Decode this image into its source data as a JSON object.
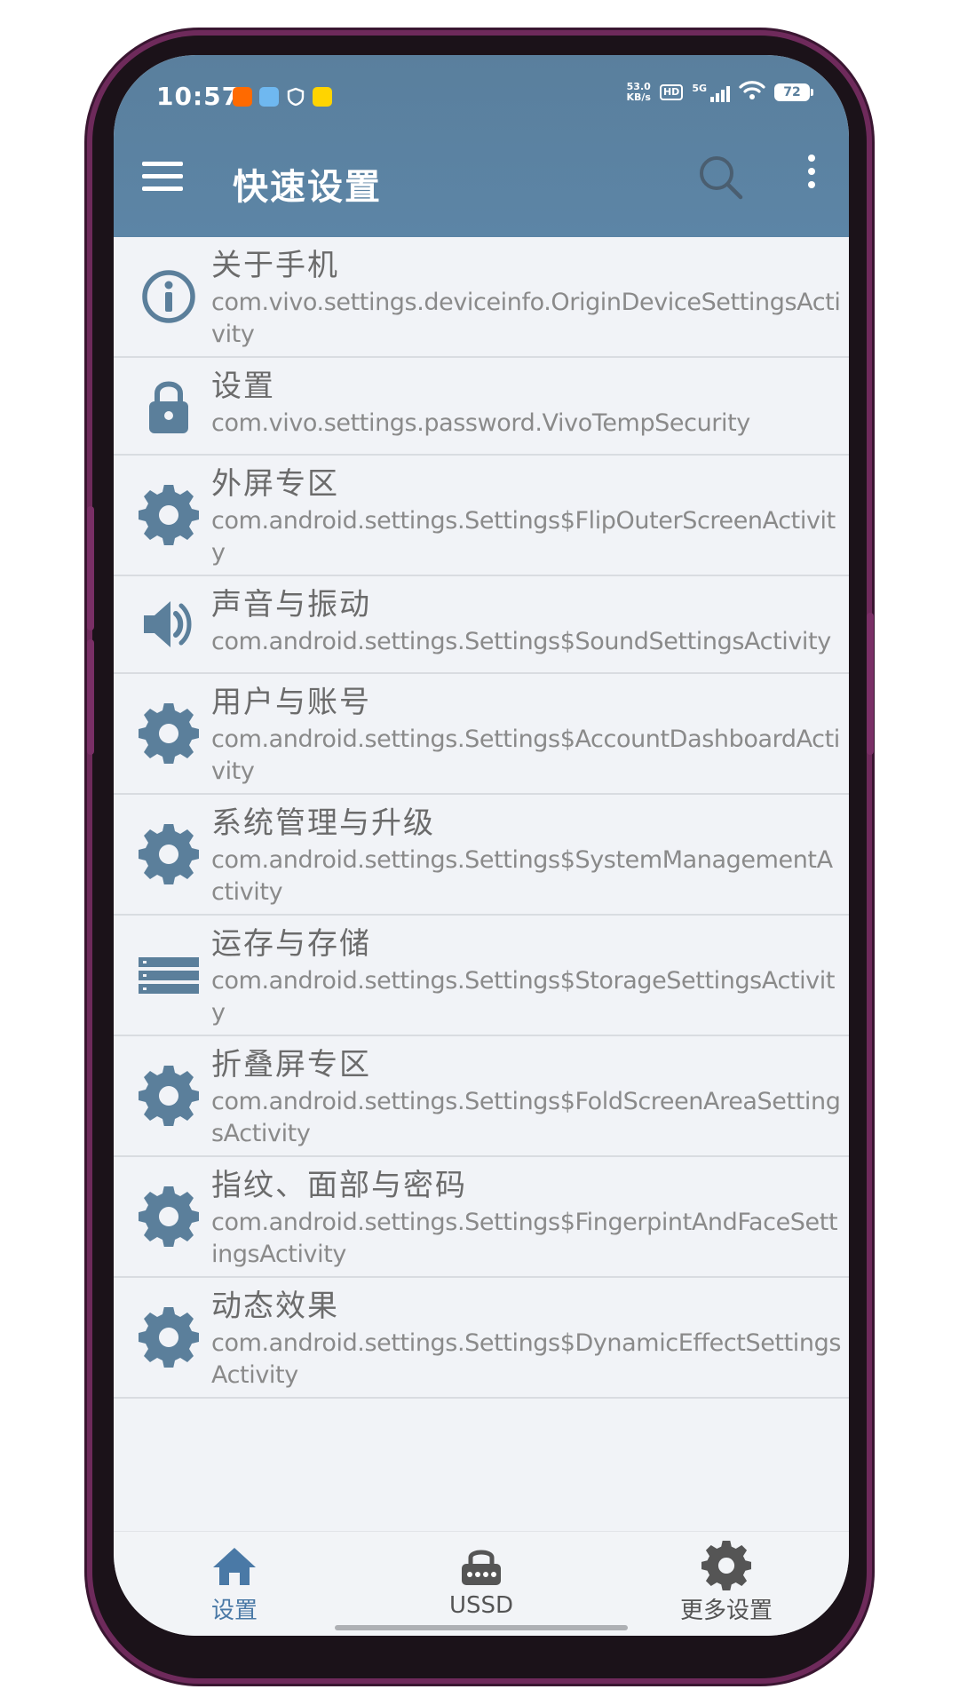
{
  "colors": {
    "header": "#5a7f9d",
    "icon": "#5b7f9b",
    "nav_active": "#4a79a6",
    "nav_inactive": "#666666"
  },
  "status_bar": {
    "time": "10:57",
    "net_speed_value": "53.0",
    "net_speed_unit": "KB/s",
    "hd": "HD",
    "network": "5G",
    "battery": "72"
  },
  "toolbar": {
    "title": "快速设置",
    "menu_icon": "hamburger-icon",
    "search_icon": "search-icon",
    "more_icon": "more-vert-icon"
  },
  "items": [
    {
      "icon": "info-icon",
      "title": "关于手机",
      "subtitle": "com.vivo.settings.deviceinfo.OriginDeviceSettingsActivity"
    },
    {
      "icon": "lock-icon",
      "title": "设置",
      "subtitle": "com.vivo.settings.password.VivoTempSecurity"
    },
    {
      "icon": "gear-icon",
      "title": "外屏专区",
      "subtitle": "com.android.settings.Settings$FlipOuterScreenActivity"
    },
    {
      "icon": "speaker-icon",
      "title": "声音与振动",
      "subtitle": "com.android.settings.Settings$SoundSettingsActivity"
    },
    {
      "icon": "gear-icon",
      "title": "用户与账号",
      "subtitle": "com.android.settings.Settings$AccountDashboardActivity"
    },
    {
      "icon": "gear-icon",
      "title": "系统管理与升级",
      "subtitle": "com.android.settings.Settings$SystemManagementActivity"
    },
    {
      "icon": "storage-icon",
      "title": "运存与存储",
      "subtitle": "com.android.settings.Settings$StorageSettingsActivity"
    },
    {
      "icon": "gear-icon",
      "title": "折叠屏专区",
      "subtitle": "com.android.settings.Settings$FoldScreenAreaSettingsActivity"
    },
    {
      "icon": "gear-icon",
      "title": "指纹、面部与密码",
      "subtitle": "com.android.settings.Settings$FingerpintAndFaceSettingsActivity"
    },
    {
      "icon": "gear-icon",
      "title": "动态效果",
      "subtitle": "com.android.settings.Settings$DynamicEffectSettingsActivity"
    }
  ],
  "bottom_nav": [
    {
      "icon": "home-icon",
      "label": "设置",
      "active": true
    },
    {
      "icon": "ussd-lock-icon",
      "label": "USSD",
      "active": false
    },
    {
      "icon": "gear-icon",
      "label": "更多设置",
      "active": false
    }
  ]
}
